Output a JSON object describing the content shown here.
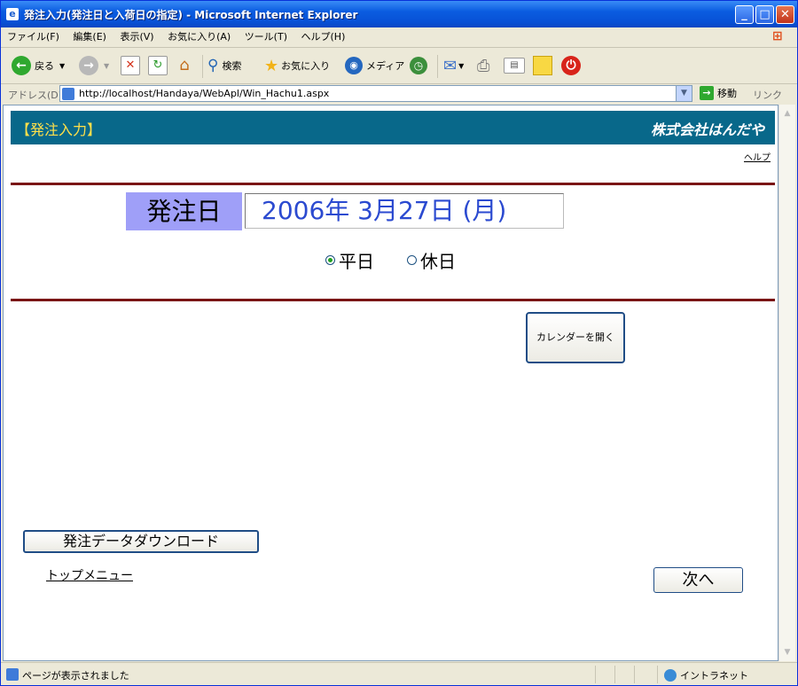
{
  "window": {
    "title": "発注入力(発注日と入荷日の指定) - Microsoft Internet Explorer"
  },
  "menu": [
    "ファイル(F)",
    "編集(E)",
    "表示(V)",
    "お気に入り(A)",
    "ツール(T)",
    "ヘルプ(H)"
  ],
  "toolbar": {
    "back": "戻る",
    "search": "検索",
    "favorites": "お気に入り",
    "media": "メディア"
  },
  "address": {
    "label": "アドレス(D)",
    "url": "http://localhost/Handaya/WebApl/Win_Hachu1.aspx",
    "go": "移動",
    "links": "リンク"
  },
  "page": {
    "banner_title": "【発注入力】",
    "company": "株式会社はんだや",
    "help": "ヘルプ",
    "date_label": "発注日",
    "date_value": "2006年 3月27日 (月)",
    "radio_weekday": "平日",
    "radio_holiday": "休日",
    "weekday_selected": true,
    "calendar_button": "カレンダーを開く",
    "download_button": "発注データダウンロード",
    "top_menu": "トップメニュー",
    "next_button": "次へ"
  },
  "status": {
    "text": "ページが表示されました",
    "zone": "イントラネット"
  },
  "colors": {
    "banner_bg": "#08688a",
    "banner_title": "#ffe04a",
    "date_label_bg": "#9f9ff8",
    "date_text": "#2b4ad0",
    "rule": "#7a1515"
  }
}
